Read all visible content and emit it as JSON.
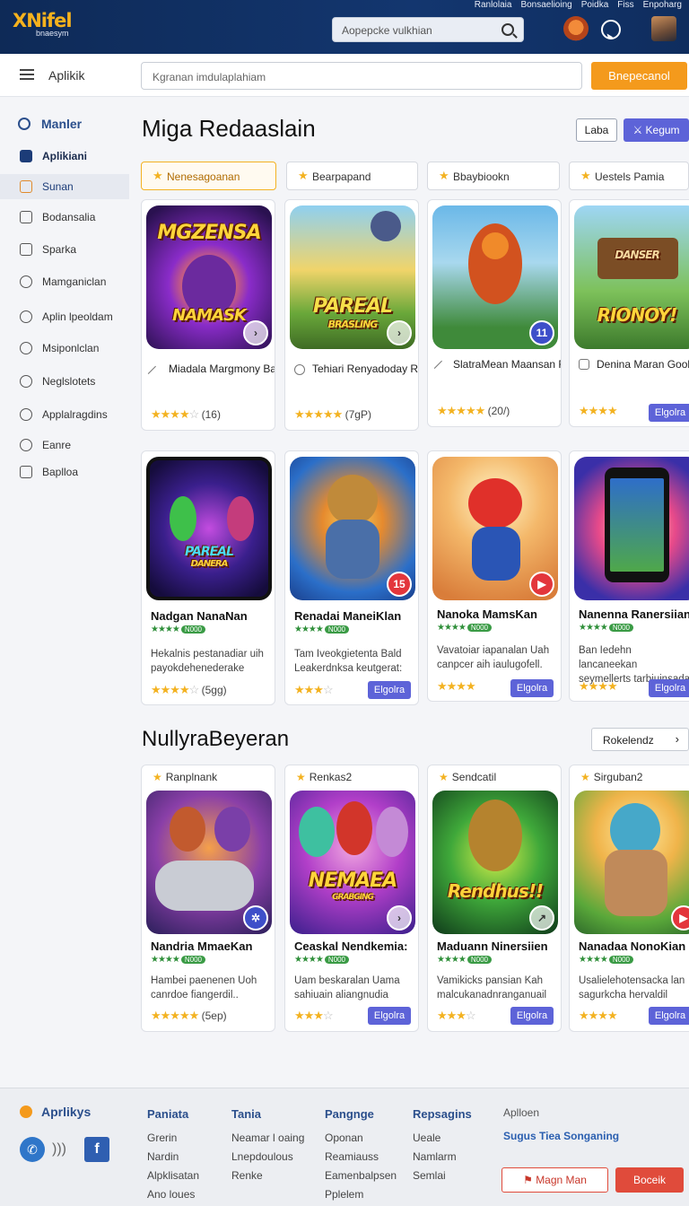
{
  "header": {
    "logo_main": "XNifel",
    "logo_sub": "bnaesym",
    "search_placeholder": "Aopepcke vulkhian",
    "links": [
      "Ranlolaia",
      "Bonsaelioing",
      "Poidka",
      "Fiss",
      "Enpoharg"
    ]
  },
  "subbar": {
    "title": "Aplikik",
    "search_placeholder": "Kgranan imdulaplahiam",
    "action_label": "Bnepecanol"
  },
  "sidebar": {
    "heading": "Manler",
    "items": [
      {
        "label": "Aplikiani",
        "icon": "music-note-icon"
      },
      {
        "label": "Sunan",
        "icon": "cart-icon"
      },
      {
        "label": "Bodansalia",
        "icon": "list-icon"
      },
      {
        "label": "Sparka",
        "icon": "calendar-icon"
      },
      {
        "label": "Mamganiclan",
        "icon": "globe-icon"
      },
      {
        "label": "Aplin lpeoldam",
        "icon": "compass-icon"
      },
      {
        "label": "Msiponlclan",
        "icon": "star-icon"
      },
      {
        "label": "Neglslotets",
        "icon": "chat-icon"
      },
      {
        "label": "Applalragdins",
        "icon": "hand-icon"
      },
      {
        "label": "Eanre",
        "icon": "message-icon"
      },
      {
        "label": "Baplloa",
        "icon": "clipboard-icon"
      }
    ]
  },
  "main": {
    "title": "Miga Redaaslain",
    "btn_outline": "Laba",
    "btn_primary": "Kegum",
    "filters": [
      "Nenesagoanan",
      "Bearpapand",
      "Bbaybiookn",
      "Uestels Pamia"
    ],
    "row1": [
      {
        "art_text": "MGZENSA",
        "art_text2": "NAMASK",
        "name": "Miadala Margmony Baglani",
        "rating": "(16)",
        "stars": 4
      },
      {
        "art_text": "PAREAL",
        "art_text2": "BRASLING",
        "name": "Tehiari Renyadoday Rayaca",
        "rating": "(7gP)",
        "stars": 5
      },
      {
        "art_text": "",
        "art_text2": "",
        "name": "SlatraMean Maansan Reyala",
        "rating": "(20/)",
        "stars": 5,
        "badge": "11"
      },
      {
        "art_text": "DANSER",
        "art_text2": "RIONOY!",
        "name": "Denina Maran Gookar Nagiara",
        "rating": "",
        "stars": 4,
        "button": "Elgolra"
      }
    ],
    "row2": [
      {
        "art_text": "PAREAL",
        "art_text2": "DANERA",
        "name": "Nadgan NanaNan",
        "desc": "Hekalnis pestanadiar uih payokdehenederake",
        "rating": "(5gg)",
        "stars": 4
      },
      {
        "name": "Renadai ManeiKlan",
        "desc": "Tam Iveokgietenta Bald Leakerdnksa keutgerat:",
        "stars": 4,
        "button": "Elgolra",
        "badge": "15"
      },
      {
        "name": "Nanoka MamsKan",
        "desc": "Vavatoiar iapanalan Uah canpcer aih iaulugofell.",
        "stars": 4,
        "button": "Elgolra"
      },
      {
        "name": "Nanenna Ranersiian",
        "desc": "Ban Iedehn lancaneekan seymellerts tarbjuinsada",
        "stars": 4,
        "button": "Elgolra"
      }
    ],
    "section2_title": "NullyraBeyeran",
    "see_more": "Rokelendz",
    "row3": [
      {
        "tag": "Ranplnank",
        "name": "Nandria MmaeKan",
        "desc": "Hambei paenenen Uoh canrdoe fiangerdil..",
        "rating": "(5ep)",
        "stars": 5
      },
      {
        "tag": "Renkas2",
        "art_text": "NEMAEA",
        "art_text2": "GRABGING",
        "name": "Ceaskal Nendkemia:",
        "desc": "Uam beskaralan Uama sahiuain aliangnudia",
        "stars": 4,
        "button": "Elgolra"
      },
      {
        "tag": "Sendcatil",
        "art_text": "Rendhus!!",
        "art_text2": "",
        "name": "Maduann Ninersiien",
        "desc": "Vamikicks pansian Kah malcukanadnranganuail",
        "stars": 4,
        "button": "Elgolra"
      },
      {
        "tag": "Sirguban2",
        "name": "Nanadaa NonoKian",
        "desc": "Usalielehotensacka lan sagurkcha hervaldil",
        "stars": 4,
        "button": "Elgolra"
      }
    ],
    "mini_badge": "N000"
  },
  "footer": {
    "brand": "Aprlikys",
    "cols": [
      {
        "head": "Paniata",
        "items": [
          "Grerin",
          "Nardin",
          "Alpklisatan",
          "Ano loues"
        ]
      },
      {
        "head": "Tania",
        "items": [
          "Neamar l oaing",
          "Lnepdoulous",
          "Renke"
        ]
      },
      {
        "head": "Pangnge",
        "items": [
          "Oponan",
          "Reamiauss",
          "Eamenbalpsen",
          "Pplelem"
        ]
      },
      {
        "head": "Repsagins",
        "items": [
          "Ueale",
          "Namlarm",
          "Semlai"
        ]
      }
    ],
    "extra": "Aplloen",
    "extra_link": "Sugus Tiea Songaning",
    "btn_outline": "Magn Man",
    "btn_primary": "Boceik"
  },
  "colors": {
    "accent": "#f49a1c",
    "primary": "#5d63d8",
    "nav": "#13366f",
    "danger": "#e04b3b"
  }
}
